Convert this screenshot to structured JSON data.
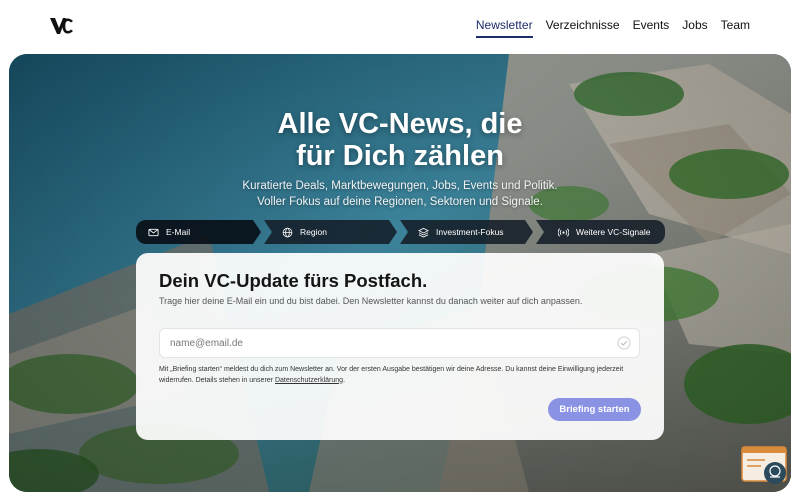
{
  "header": {
    "logo_text": "VC",
    "nav": [
      {
        "label": "Newsletter",
        "active": true
      },
      {
        "label": "Verzeichnisse",
        "active": false
      },
      {
        "label": "Events",
        "active": false
      },
      {
        "label": "Jobs",
        "active": false
      },
      {
        "label": "Team",
        "active": false
      }
    ]
  },
  "hero": {
    "headline_line1": "Alle VC-News, die",
    "headline_line2": "für Dich zählen",
    "sub_line1": "Kuratierte Deals, Marktbewegungen, Jobs, Events und Politik.",
    "sub_line2": "Voller Fokus auf deine Regionen, Sektoren und Signale."
  },
  "tabs": [
    {
      "label": "E-Mail",
      "icon": "mail-icon",
      "active": true
    },
    {
      "label": "Region",
      "icon": "globe-icon",
      "active": false
    },
    {
      "label": "Investment-Fokus",
      "icon": "layers-icon",
      "active": false
    },
    {
      "label": "Weitere VC-Signale",
      "icon": "signal-icon",
      "active": false
    }
  ],
  "form": {
    "title": "Dein VC-Update fürs Postfach.",
    "description": "Trage hier deine E-Mail ein und du bist dabei. Den Newsletter kannst du danach weiter auf dich anpassen.",
    "email_placeholder": "name@email.de",
    "email_value": "",
    "legal_text": "Mit „Briefing starten“ meldest du dich zum Newsletter an. Vor der ersten Ausgabe bestätigen wir deine Adresse. Du kannst deine Einwilligung jederzeit widerrufen. Details stehen in unserer",
    "legal_link": "Datenschutzerklärung",
    "legal_end": ".",
    "submit_label": "Briefing starten"
  },
  "colors": {
    "nav_active": "#1d2c6b",
    "submit_bg": "#8a93e3",
    "tab_bg": "#141e28"
  }
}
